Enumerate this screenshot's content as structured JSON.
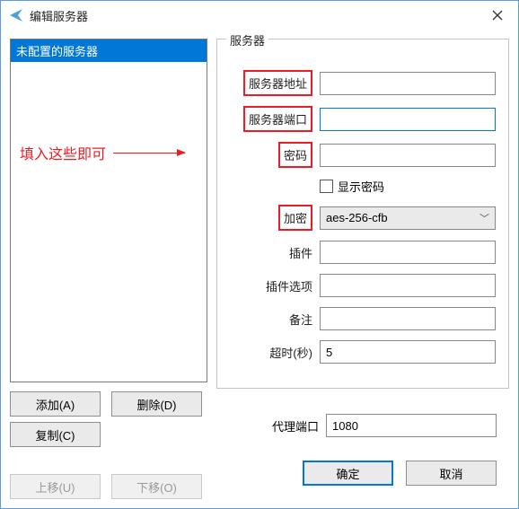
{
  "window": {
    "title": "编辑服务器"
  },
  "sidebar": {
    "items": [
      {
        "label": "未配置的服务器"
      }
    ],
    "annotation": "填入这些即可"
  },
  "left_buttons": {
    "add": "添加(A)",
    "delete": "删除(D)",
    "copy": "复制(C)",
    "move_up": "上移(U)",
    "move_down": "下移(O)"
  },
  "group": {
    "legend": "服务器",
    "labels": {
      "server_addr": "服务器地址",
      "server_port": "服务器端口",
      "password": "密码",
      "show_password": "显示密码",
      "encryption": "加密",
      "plugin": "插件",
      "plugin_opts": "插件选项",
      "remarks": "备注",
      "timeout": "超时(秒)"
    },
    "values": {
      "server_addr": "",
      "server_port": "",
      "password": "",
      "show_password_checked": false,
      "encryption": "aes-256-cfb",
      "plugin": "",
      "plugin_opts": "",
      "remarks": "",
      "timeout": "5"
    }
  },
  "proxy": {
    "label": "代理端口",
    "value": "1080"
  },
  "footer": {
    "ok": "确定",
    "cancel": "取消"
  }
}
